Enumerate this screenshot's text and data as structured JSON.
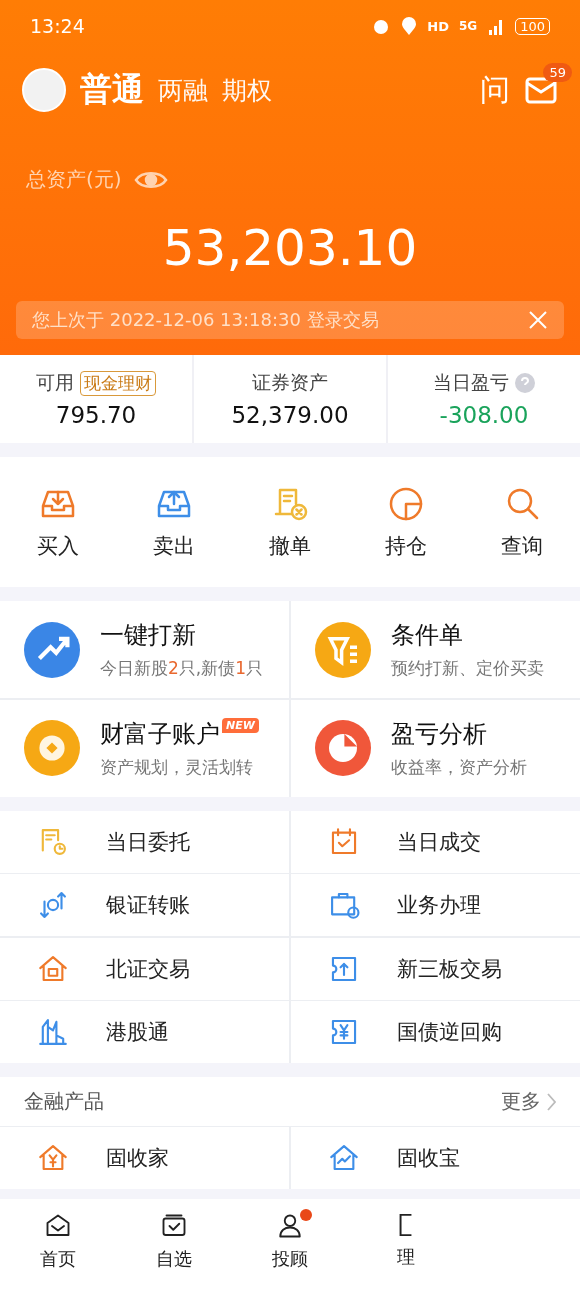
{
  "status_bar": {
    "time": "13:24",
    "network": "5G",
    "hd": "HD",
    "battery": "100"
  },
  "header": {
    "account_tabs": [
      {
        "label": "普通",
        "selected": true
      },
      {
        "label": "两融",
        "selected": false
      },
      {
        "label": "期权",
        "selected": false
      }
    ],
    "ask_label": "问",
    "mail_badge": "59"
  },
  "assets": {
    "label": "总资产(元)",
    "total": "53,203.10",
    "login_notice": "您上次于 2022-12-06  13:18:30 登录交易"
  },
  "summary": [
    {
      "label": "可用",
      "tag": "现金理财",
      "value": "795.70",
      "color": "#111111",
      "help": false
    },
    {
      "label": "证券资产",
      "value": "52,379.00",
      "color": "#111111",
      "help": false
    },
    {
      "label": "当日盈亏",
      "value": "-308.00",
      "color": "#1aa35b",
      "help": true
    }
  ],
  "quick_actions": [
    {
      "label": "买入"
    },
    {
      "label": "卖出"
    },
    {
      "label": "撤单"
    },
    {
      "label": "持仓"
    },
    {
      "label": "查询"
    }
  ],
  "features": [
    {
      "title": "一键打新",
      "new": false,
      "subtitle_parts": [
        {
          "text": "今日新股",
          "highlight": false
        },
        {
          "text": "2",
          "highlight": true
        },
        {
          "text": "只,新债",
          "highlight": false
        },
        {
          "text": "1",
          "highlight": true
        },
        {
          "text": "只",
          "highlight": false
        }
      ]
    },
    {
      "title": "条件单",
      "new": false,
      "subtitle_parts": [
        {
          "text": "预约打新、定价买卖",
          "highlight": false
        }
      ]
    },
    {
      "title": "财富子账户",
      "new": true,
      "new_label": "NEW",
      "subtitle_parts": [
        {
          "text": "资产规划，灵活划转",
          "highlight": false
        }
      ]
    },
    {
      "title": "盈亏分析",
      "new": false,
      "subtitle_parts": [
        {
          "text": "收益率，资产分析",
          "highlight": false
        }
      ]
    }
  ],
  "services": [
    {
      "label": "当日委托"
    },
    {
      "label": "当日成交"
    },
    {
      "label": "银证转账"
    },
    {
      "label": "业务办理"
    },
    {
      "label": "北证交易"
    },
    {
      "label": "新三板交易"
    },
    {
      "label": "港股通"
    },
    {
      "label": "国债逆回购"
    }
  ],
  "products": {
    "title": "金融产品",
    "more": "更多",
    "items": [
      {
        "label": "固收家"
      },
      {
        "label": "固收宝"
      }
    ]
  },
  "bottom_nav": [
    {
      "label": "首页",
      "dot": false
    },
    {
      "label": "自选",
      "dot": false
    },
    {
      "label": "投顾",
      "dot": true
    },
    {
      "label": "理",
      "dot": false
    }
  ]
}
